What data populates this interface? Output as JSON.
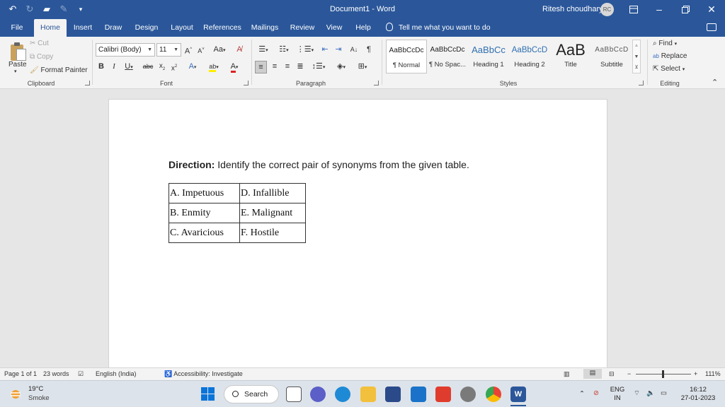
{
  "window": {
    "title": "Document1  -  Word",
    "user_name": "Ritesh choudhary",
    "avatar_initials": "RC"
  },
  "quick_access": [
    "undo-icon",
    "redo-icon",
    "open-icon",
    "touch-mode-icon",
    "customize-icon"
  ],
  "tabs": [
    {
      "label": "File"
    },
    {
      "label": "Home"
    },
    {
      "label": "Insert"
    },
    {
      "label": "Draw"
    },
    {
      "label": "Design"
    },
    {
      "label": "Layout"
    },
    {
      "label": "References"
    },
    {
      "label": "Mailings"
    },
    {
      "label": "Review"
    },
    {
      "label": "View"
    },
    {
      "label": "Help"
    }
  ],
  "active_tab": "Home",
  "tell_me": "Tell me what you want to do",
  "clipboard": {
    "paste": "Paste",
    "cut": "Cut",
    "copy": "Copy",
    "format_painter": "Format Painter",
    "group": "Clipboard"
  },
  "font": {
    "family": "Calibri (Body)",
    "size": "11",
    "change_case": "Aa",
    "group": "Font"
  },
  "paragraph": {
    "group": "Paragraph"
  },
  "styles": {
    "group": "Styles",
    "items": [
      {
        "preview": "AaBbCcDc",
        "name": "¶ Normal"
      },
      {
        "preview": "AaBbCcDc",
        "name": "¶ No Spac..."
      },
      {
        "preview": "AaBbCc",
        "name": "Heading 1"
      },
      {
        "preview": "AaBbCcD",
        "name": "Heading 2"
      },
      {
        "preview": "AaB",
        "name": "Title"
      },
      {
        "preview": "AaBbCcD",
        "name": "Subtitle"
      }
    ]
  },
  "editing": {
    "find": "Find",
    "replace": "Replace",
    "select": "Select",
    "group": "Editing"
  },
  "document": {
    "direction_label": "Direction:",
    "direction_text": " Identify the correct pair of synonyms from the given table.",
    "table": [
      [
        "A. Impetuous",
        "D. Infallible"
      ],
      [
        "B. Enmity",
        "E. Malignant"
      ],
      [
        "C. Avaricious",
        "F. Hostile"
      ]
    ]
  },
  "statusbar": {
    "page": "Page 1 of 1",
    "words": "23 words",
    "language": "English (India)",
    "accessibility": "Accessibility: Investigate",
    "zoom": "111%",
    "zoom_minus": "−",
    "zoom_plus": "+"
  },
  "taskbar": {
    "weather_temp": "19°C",
    "weather_desc": "Smoke",
    "search": "Search",
    "lang_line1": "ENG",
    "lang_line2": "IN",
    "time": "16:12",
    "date": "27-01-2023"
  },
  "colors": {
    "word_blue": "#2b579a",
    "ribbon_bg": "#f3f3f3",
    "canvas_bg": "#e6e6e6",
    "font_color_red": "#e02020",
    "highlight_yellow": "#ffee00"
  }
}
